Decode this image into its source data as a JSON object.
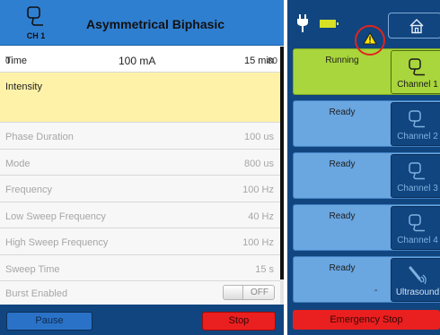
{
  "left": {
    "channel_short": "CH 1",
    "waveform": "Asymmetrical Biphasic",
    "params": [
      {
        "label": "Time",
        "value": "15 min"
      },
      {
        "label": "Phase Duration",
        "value": "100 us"
      },
      {
        "label": "Mode",
        "value": "800 us"
      },
      {
        "label": "Frequency",
        "value": "100 Hz"
      },
      {
        "label": "Low Sweep Frequency",
        "value": "40 Hz"
      },
      {
        "label": "High Sweep Frequency",
        "value": "100 Hz"
      },
      {
        "label": "Sweep Time",
        "value": "15 s"
      },
      {
        "label": "Burst Enabled",
        "value": ""
      }
    ],
    "intensity": {
      "label": "Intensity",
      "min": "0",
      "value": "100 mA",
      "max": "80"
    },
    "burst_toggle": {
      "state": "OFF"
    },
    "pause_label": "Pause",
    "stop_label": "Stop"
  },
  "right": {
    "channels": [
      {
        "status": "Running",
        "label": "Channel 1",
        "icon": "electrode-icon",
        "extra": ""
      },
      {
        "status": "Ready",
        "label": "Channel 2",
        "icon": "electrode-icon",
        "extra": ""
      },
      {
        "status": "Ready",
        "label": "Channel 3",
        "icon": "electrode-icon",
        "extra": ""
      },
      {
        "status": "Ready",
        "label": "Channel 4",
        "icon": "electrode-icon",
        "extra": ""
      },
      {
        "status": "Ready",
        "label": "Ultrasound",
        "icon": "ultrasound-icon",
        "extra": "-"
      }
    ],
    "emergency_label": "Emergency Stop"
  },
  "colors": {
    "header_blue": "#2f7fd1",
    "dark_blue": "#11457f",
    "running_green": "#a9d63c",
    "ready_blue": "#6aa6e0",
    "stop_red": "#ea1f1f",
    "intensity_yellow": "#fdf2a8",
    "battery_yellow": "#d7e025"
  }
}
